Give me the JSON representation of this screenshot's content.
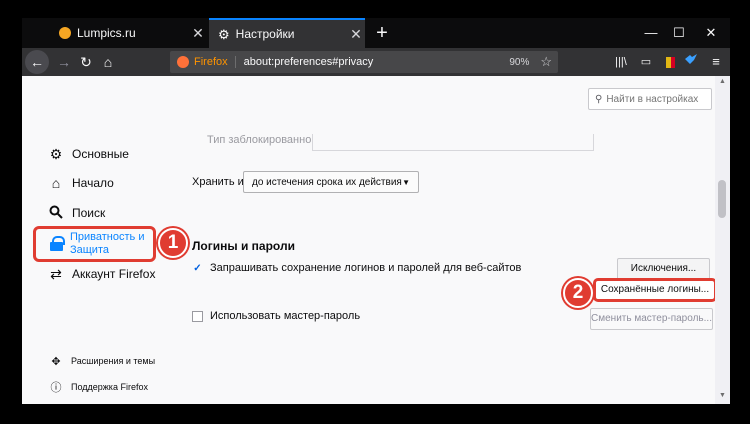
{
  "tabs": [
    {
      "title": "Lumpics.ru",
      "icon": "lumpics-favicon"
    },
    {
      "title": "Настройки",
      "icon": "gear-icon"
    }
  ],
  "tab_close": "✕",
  "new_tab": "+",
  "window_controls": {
    "minimize": "—",
    "maximize": "☐",
    "close": "✕"
  },
  "nav": {
    "back": "←",
    "forward": "→",
    "reload": "↻",
    "home": "⌂"
  },
  "urlbar": {
    "brand": "Firefox",
    "url": "about:preferences#privacy",
    "zoom": "90%",
    "star": "☆"
  },
  "toolbar": {
    "library": "|||\\",
    "sidebar": "▭",
    "menu": "≡"
  },
  "search": {
    "placeholder": "Найти в настройках"
  },
  "sidebar": {
    "items": [
      {
        "label": "Основные",
        "icon": "gear-icon"
      },
      {
        "label": "Начало",
        "icon": "home-icon"
      },
      {
        "label": "Поиск",
        "icon": "search-icon"
      },
      {
        "label": "Приватность и Защита",
        "icon": "lock-icon"
      },
      {
        "label": "Аккаунт Firefox",
        "icon": "sync-icon"
      }
    ],
    "footer": [
      {
        "label": "Расширения и темы",
        "icon": "puzzle-icon"
      },
      {
        "label": "Поддержка Firefox",
        "icon": "help-icon"
      }
    ]
  },
  "annotations": {
    "badge1": "1",
    "badge2": "2",
    "color": "#e03c31"
  },
  "main": {
    "cut_label": "Тип заблокированного",
    "keep_label": "Хранить их",
    "keep_value": "до истечения срока их действия",
    "section_title": "Логины и пароли",
    "ask_save_label": "Запрашивать сохранение логинов и паролей для веб-сайтов",
    "exceptions_button": "Исключения...",
    "saved_logins_button": "Сохранённые логины...",
    "master_password_label": "Использовать мастер-пароль",
    "change_master_button": "Сменить мастер-пароль..."
  },
  "accent_color": "#0a84ff"
}
